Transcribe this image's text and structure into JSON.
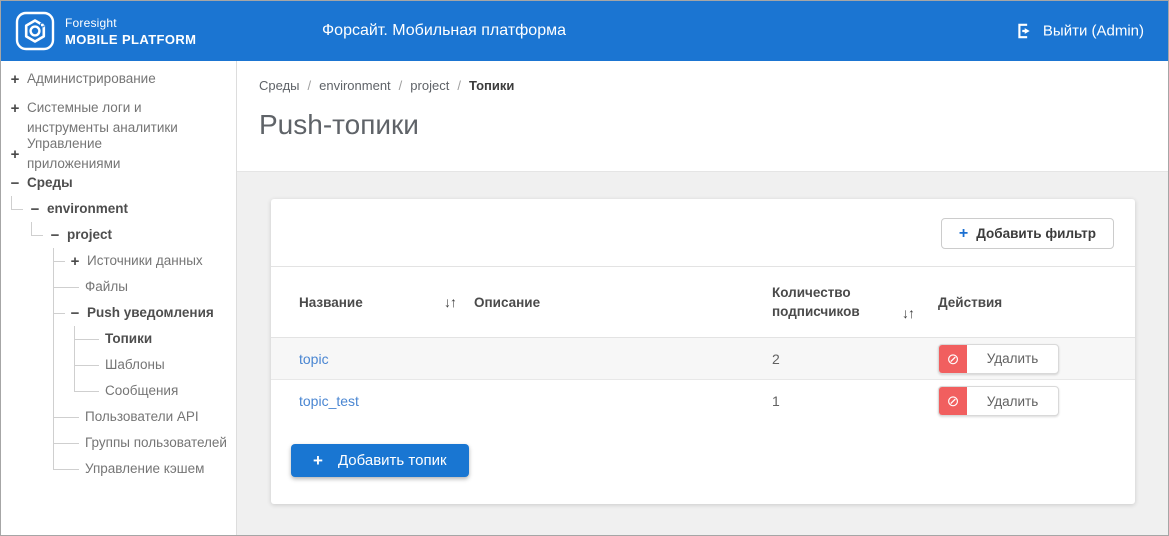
{
  "header": {
    "logo_line1": "Foresight",
    "logo_line2": "MOBILE PLATFORM",
    "title": "Форсайт. Мобильная платформа",
    "logout_label": "Выйти (Admin)"
  },
  "icons": {
    "plus": "+",
    "minus": "−",
    "sort": "↓↑",
    "prohibit": "⊘"
  },
  "sidebar": {
    "items": [
      {
        "label": "Администрирование",
        "state": "collapsed"
      },
      {
        "label": "Системные логи и инструменты аналитики",
        "state": "collapsed"
      },
      {
        "label": "Управление приложениями",
        "state": "collapsed"
      },
      {
        "label": "Среды",
        "state": "expanded"
      },
      {
        "label": "environment",
        "state": "expanded"
      },
      {
        "label": "project",
        "state": "expanded"
      },
      {
        "label": "Источники данных",
        "state": "collapsed"
      },
      {
        "label": "Файлы",
        "state": "leaf"
      },
      {
        "label": "Push уведомления",
        "state": "expanded"
      },
      {
        "label": "Топики",
        "state": "leaf-selected"
      },
      {
        "label": "Шаблоны",
        "state": "leaf"
      },
      {
        "label": "Сообщения",
        "state": "leaf"
      },
      {
        "label": "Пользователи API",
        "state": "leaf"
      },
      {
        "label": "Группы пользователей",
        "state": "leaf"
      },
      {
        "label": "Управление кэшем",
        "state": "leaf"
      }
    ]
  },
  "breadcrumb": {
    "items": [
      "Среды",
      "environment",
      "project",
      "Топики"
    ],
    "separator": "/"
  },
  "page": {
    "title": "Push-топики"
  },
  "toolbar": {
    "add_filter_label": "Добавить фильтр"
  },
  "table": {
    "columns": {
      "name": "Название",
      "description": "Описание",
      "subscribers": "Количество подписчиков",
      "actions": "Действия"
    },
    "rows": [
      {
        "name": "topic",
        "description": "",
        "subscribers": "2"
      },
      {
        "name": "topic_test",
        "description": "",
        "subscribers": "1"
      }
    ]
  },
  "actions": {
    "delete_label": "Удалить",
    "add_topic_label": "Добавить топик"
  },
  "colors": {
    "header_blue": "#1b75d2",
    "primary_blue": "#1976d2",
    "link_blue": "#4a86d2",
    "danger_red": "#f15f5f",
    "page_gray": "#f0f0f0",
    "stripe_gray": "#f7f7f7"
  }
}
